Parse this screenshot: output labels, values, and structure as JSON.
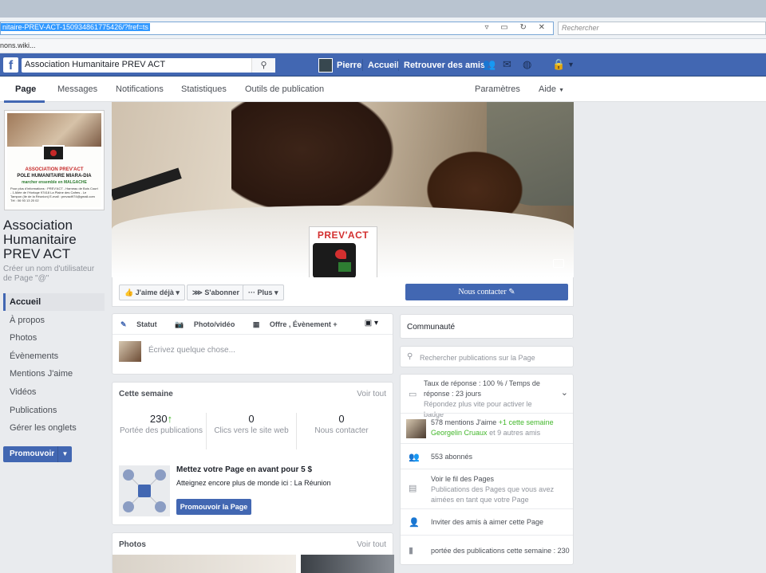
{
  "browser": {
    "url": "nitaire-PREV-ACT-150934861775426/?fref=ts",
    "search_placeholder": "Rechercher",
    "bookmark": "nons.wiki..."
  },
  "fb": {
    "logo": "f",
    "search_value": "Association Humanitaire PREV ACT",
    "user": "Pierre",
    "home": "Accueil",
    "find_friends": "Retrouver des amis"
  },
  "tabs": {
    "page": "Page",
    "messages": "Messages",
    "notifications": "Notifications",
    "stats": "Statistiques",
    "tools": "Outils de publication",
    "settings": "Paramètres",
    "help": "Aide"
  },
  "profile": {
    "association": "ASSOCIATION PREV'ACT",
    "pole": "POLE HUMANITAIRE MIARA-DIA",
    "tagline": "marcher ensemble en MALGACHE",
    "info": "Pour plus d'informations : PREV'ACT - Hameau de Bois Court - 1 Allée de l'Horloge 97418 La Plaine des Cafres - Le Tampon (Ile de la Réunion) E-mail : prevact974@gmail.com Tél : 06 93 13 20 02"
  },
  "page": {
    "name": "Association Humanitaire PREV ACT",
    "create_username": "Créer un nom d'utilisateur de Page \"@\""
  },
  "leftnav": [
    "Accueil",
    "À propos",
    "Photos",
    "Évènements",
    "Mentions J'aime",
    "Vidéos",
    "Publications",
    "Gérer les onglets"
  ],
  "promote_button": "Promouvoir",
  "cover_logo": "PREV'ACT",
  "actions": {
    "like": "J'aime déjà",
    "follow": "S'abonner",
    "more": "Plus",
    "contact": "Nous contacter"
  },
  "composer": {
    "status": "Statut",
    "photo": "Photo/vidéo",
    "offer": "Offre , Évènement +",
    "placeholder": "Écrivez quelque chose..."
  },
  "week": {
    "title": "Cette semaine",
    "see_all": "Voir tout",
    "reach_value": "230",
    "reach_label": "Portée des publications",
    "clicks_value": "0",
    "clicks_label": "Clics vers le site web",
    "contacts_value": "0",
    "contacts_label": "Nous contacter",
    "promo_title": "Mettez votre Page en avant pour 5 $",
    "promo_sub": "Atteignez encore plus de monde ici : La Réunion",
    "promo_cta": "Promouvoir la Page"
  },
  "photos": {
    "title": "Photos",
    "see_all": "Voir tout"
  },
  "community": {
    "title": "Communauté",
    "search_placeholder": "Rechercher publications sur la Page",
    "response_rate": "Taux de réponse : 100 % / Temps de réponse : 23 jours",
    "response_hint": "Répondez plus vite pour activer le badge",
    "likes": "578 mentions J'aime",
    "likes_week": "+1 cette semaine",
    "liker_name": "Georgelin Cruaux",
    "liker_others": "et 9 autres amis",
    "followers": "553 abonnés",
    "feed_title": "Voir le fil des Pages",
    "feed_sub": "Publications des Pages que vous avez aimées en tant que votre Page",
    "invite": "Inviter des amis à aimer cette Page",
    "reach_week": "portée des publications cette semaine : 230"
  }
}
